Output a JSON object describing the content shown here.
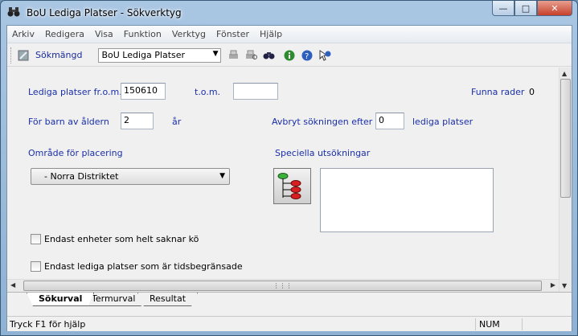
{
  "window": {
    "title": "BoU Lediga Platser - Sökverktyg",
    "controls": {
      "minimize": "—",
      "maximize": "□",
      "close": "✕"
    }
  },
  "menu": [
    "Arkiv",
    "Redigera",
    "Visa",
    "Funktion",
    "Verktyg",
    "Fönster",
    "Hjälp"
  ],
  "toolbar": {
    "label": "Sökmängd",
    "selected": "BoU Lediga Platser"
  },
  "form": {
    "from_label": "Lediga platser fr.o.m.",
    "from_value": "150610",
    "to_label": "t.o.m.",
    "to_value": "",
    "found_label": "Funna rader",
    "found_value": "0",
    "age_label": "För barn av åldern",
    "age_value": "2",
    "age_unit": "år",
    "abort_label": "Avbryt sökningen efter",
    "abort_value": "0",
    "abort_unit": "lediga platser",
    "area_label": "Område för placering",
    "area_selected": "- Norra Distriktet",
    "special_label": "Speciella utsökningar",
    "check1": "Endast enheter som helt saknar kö",
    "check2": "Endast lediga platser som är tidsbegränsade"
  },
  "tabs": [
    "Sökurval",
    "Termurval",
    "Resultat"
  ],
  "status": {
    "help": "Tryck F1 för hjälp",
    "num": "NUM"
  }
}
